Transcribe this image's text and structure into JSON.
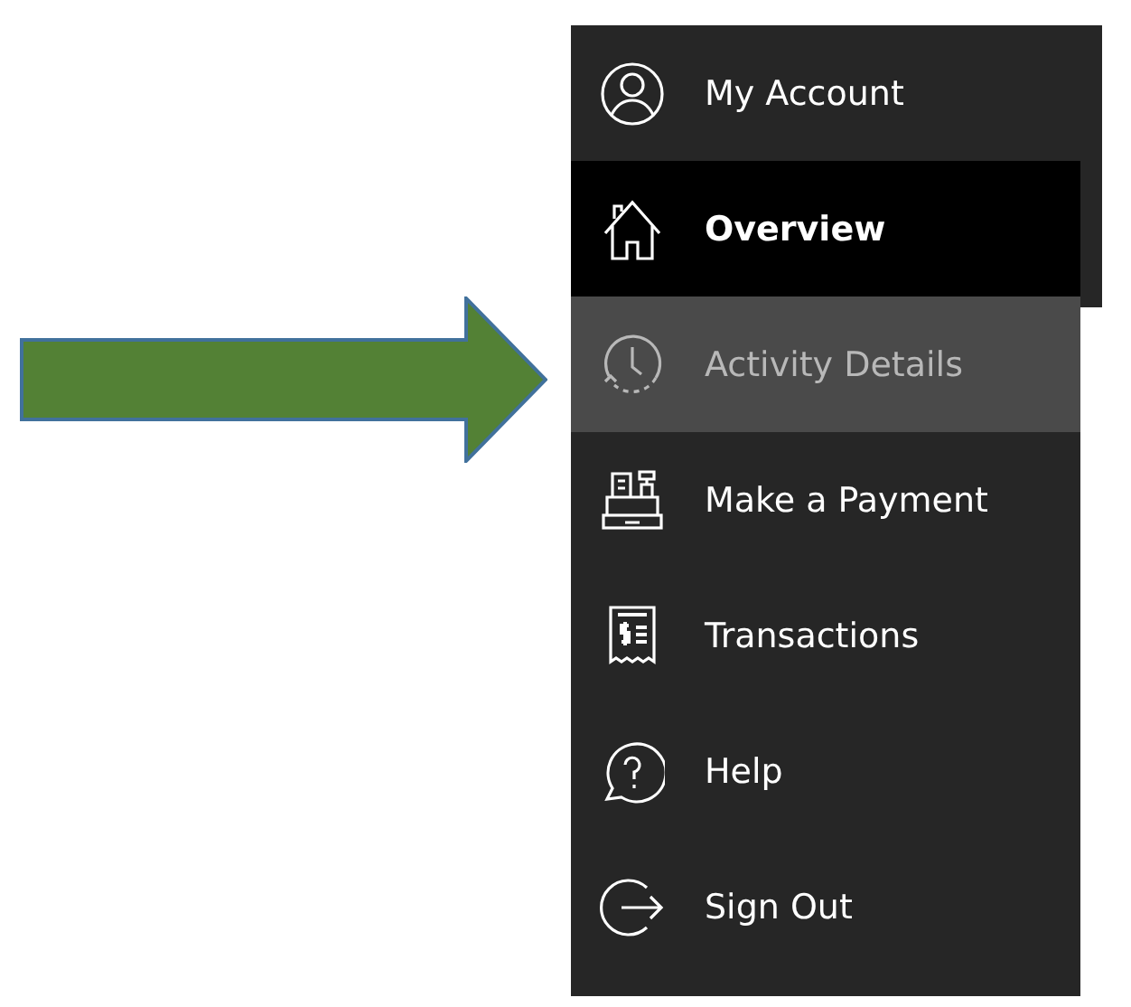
{
  "menu": {
    "items": [
      {
        "kind": "account",
        "label": "My Account",
        "selected": false,
        "highlighted": false
      },
      {
        "kind": "home",
        "label": "Overview",
        "selected": true,
        "highlighted": false
      },
      {
        "kind": "activity",
        "label": "Activity Details",
        "selected": false,
        "highlighted": true
      },
      {
        "kind": "payment",
        "label": "Make a Payment",
        "selected": false,
        "highlighted": false
      },
      {
        "kind": "transactions",
        "label": "Transactions",
        "selected": false,
        "highlighted": false
      },
      {
        "kind": "help",
        "label": "Help",
        "selected": false,
        "highlighted": false
      },
      {
        "kind": "signout",
        "label": "Sign Out",
        "selected": false,
        "highlighted": false
      }
    ]
  }
}
